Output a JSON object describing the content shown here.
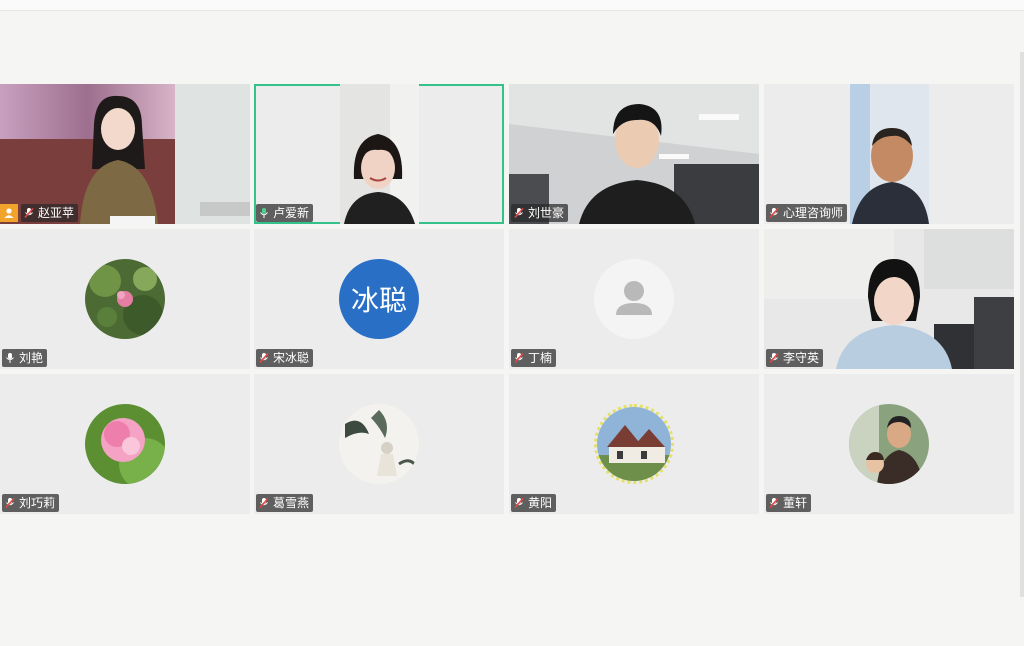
{
  "colors": {
    "accent": "#33c28a",
    "host": "#f2a32b",
    "label_bg": "#3a3a3a",
    "avatar_blue": "#2a6fc6"
  },
  "participants": [
    {
      "name": "赵亚苹",
      "role": "host",
      "audio": "muted",
      "view": "video"
    },
    {
      "name": "卢爱新",
      "audio": "speaking",
      "view": "video",
      "active": true
    },
    {
      "name": "刘世豪",
      "audio": "muted",
      "view": "video"
    },
    {
      "name": "心理咨询师",
      "audio": "muted",
      "view": "video"
    },
    {
      "name": "刘艳",
      "audio": "unmuted",
      "view": "avatar",
      "avatar": "flower-photo"
    },
    {
      "name": "宋冰聪",
      "audio": "muted",
      "view": "avatar",
      "avatar_text": "冰聪"
    },
    {
      "name": "丁楠",
      "audio": "muted",
      "view": "avatar",
      "avatar": "default-person-icon"
    },
    {
      "name": "李守英",
      "audio": "muted",
      "view": "video"
    },
    {
      "name": "刘巧莉",
      "audio": "muted",
      "view": "avatar",
      "avatar": "pink-flower-photo"
    },
    {
      "name": "葛雪燕",
      "audio": "muted",
      "view": "avatar",
      "avatar": "painting-photo"
    },
    {
      "name": "黄阳",
      "audio": "muted",
      "view": "avatar",
      "avatar": "house-photo"
    },
    {
      "name": "董轩",
      "audio": "muted",
      "view": "avatar",
      "avatar": "people-photo"
    }
  ]
}
